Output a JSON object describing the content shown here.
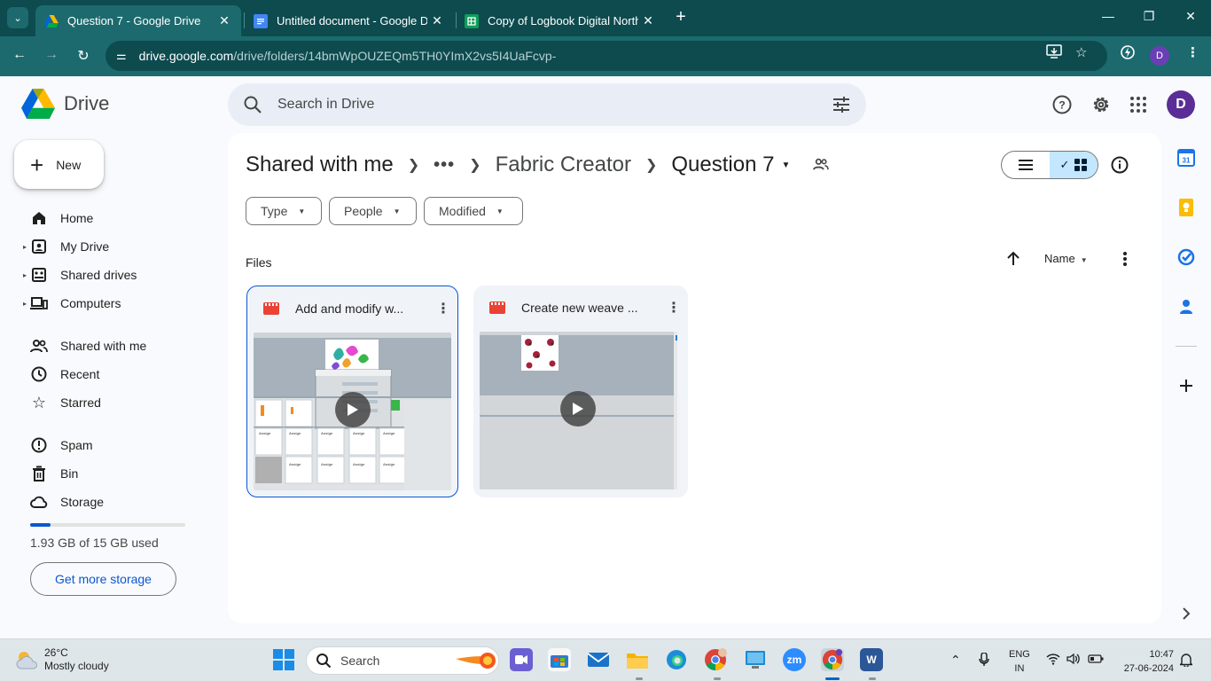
{
  "browser": {
    "tabs": [
      {
        "title": "Question 7 - Google Drive",
        "active": true
      },
      {
        "title": "Untitled document - Google Do",
        "active": false
      },
      {
        "title": "Copy of Logbook Digital North",
        "active": false
      }
    ],
    "url_host": "drive.google.com",
    "url_path": "/drive/folders/14bmWpOUZEQm5TH0YImX2vs5I4UaFcvp-",
    "profile_initial": "D"
  },
  "drive": {
    "logo_text": "Drive",
    "search_placeholder": "Search in Drive",
    "avatar_initial": "D",
    "new_label": "New",
    "nav": {
      "home": "Home",
      "my_drive": "My Drive",
      "shared_drives": "Shared drives",
      "computers": "Computers",
      "shared_with_me": "Shared with me",
      "recent": "Recent",
      "starred": "Starred",
      "spam": "Spam",
      "bin": "Bin",
      "storage": "Storage"
    },
    "storage_used_fraction": 0.129,
    "storage_text": "1.93 GB of 15 GB used",
    "get_storage_label": "Get more storage",
    "breadcrumb": {
      "root": "Shared with me",
      "middle": "Fabric Creator",
      "current": "Question 7"
    },
    "filters": {
      "type": "Type",
      "people": "People",
      "modified": "Modified"
    },
    "section_label": "Files",
    "sort_label": "Name",
    "files": [
      {
        "name": "Add and modify w...",
        "kind": "video"
      },
      {
        "name": "Create new weave ...",
        "kind": "video"
      }
    ],
    "accent": "#0b57d0"
  },
  "taskbar": {
    "weather_temp": "26°C",
    "weather_desc": "Mostly cloudy",
    "search_label": "Search",
    "lang_line1": "ENG",
    "lang_line2": "IN",
    "time": "10:47",
    "date": "27-06-2024"
  }
}
